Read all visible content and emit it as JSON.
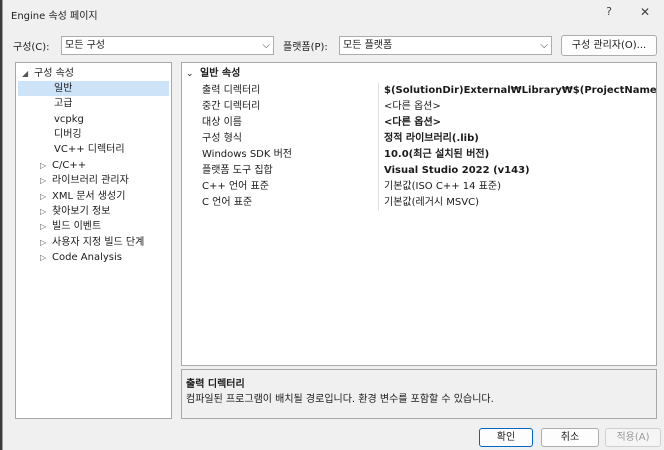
{
  "window": {
    "title": "Engine 속성 페이지",
    "help_glyph": "?",
    "close_glyph": "✕"
  },
  "toolbar": {
    "config_label": "구성(C):",
    "config_value": "모든 구성",
    "platform_label": "플랫폼(P):",
    "platform_value": "모든 플랫폼",
    "config_manager_label": "구성 관리자(O)...",
    "dropdown_glyph": "⌵"
  },
  "tree": {
    "root": {
      "label": "구성 속성",
      "expander": "◢"
    },
    "leaf_items": [
      {
        "label": "일반"
      },
      {
        "label": "고급"
      },
      {
        "label": "vcpkg"
      },
      {
        "label": "디버깅"
      },
      {
        "label": "VC++ 디렉터리"
      }
    ],
    "group_items": [
      {
        "label": "C/C++",
        "expander": "▷"
      },
      {
        "label": "라이브러리 관리자",
        "expander": "▷"
      },
      {
        "label": "XML 문서 생성기",
        "expander": "▷"
      },
      {
        "label": "찾아보기 정보",
        "expander": "▷"
      },
      {
        "label": "빌드 이벤트",
        "expander": "▷"
      },
      {
        "label": "사용자 지정 빌드 단계",
        "expander": "▷"
      },
      {
        "label": "Code Analysis",
        "expander": "▷"
      }
    ]
  },
  "grid": {
    "category": {
      "label": "일반 속성",
      "expander": "⌄"
    },
    "rows": [
      {
        "name": "출력 디렉터리",
        "value": "$(SolutionDir)External₩Library₩$(ProjectName)₩"
      },
      {
        "name": "중간 디렉터리",
        "value": "<다른 옵션>"
      },
      {
        "name": "대상 이름",
        "value": "<다른 옵션>"
      },
      {
        "name": "구성 형식",
        "value": "정적 라이브러리(.lib)"
      },
      {
        "name": "Windows SDK 버전",
        "value": "10.0(최근 설치된 버전)"
      },
      {
        "name": "플랫폼 도구 집합",
        "value": "Visual Studio 2022 (v143)"
      },
      {
        "name": "C++ 언어 표준",
        "value": "기본값(ISO C++ 14 표준)"
      },
      {
        "name": "C 언어 표준",
        "value": "기본값(레거시 MSVC)"
      }
    ]
  },
  "description": {
    "title": "출력 디렉터리",
    "text": "컴파일된 프로그램이 배치될 경로입니다. 환경 변수를 포함할 수 있습니다."
  },
  "buttons": {
    "ok": "확인",
    "cancel": "취소",
    "apply": "적용(A)"
  }
}
